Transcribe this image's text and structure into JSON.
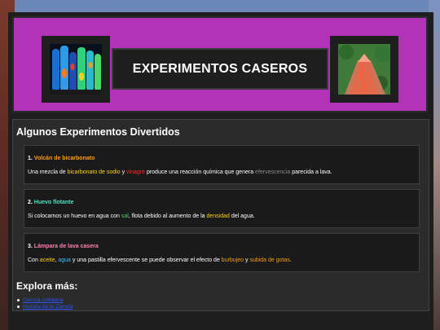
{
  "header": {
    "title": "EXPERIMENTOS CASEROS",
    "images": {
      "left": "lava-lamps-image",
      "right": "volcano-image"
    }
  },
  "main": {
    "section_title": "Algunos Experimentos Divertidos",
    "experiments": [
      {
        "number": "1.",
        "title": "Volcán de bicarbonato",
        "title_color": "#ff9a1a",
        "segments": [
          {
            "text": "Una mezcla de ",
            "color": "#ffffff"
          },
          {
            "text": "bicarbonato de sodio",
            "color": "#ffd21a"
          },
          {
            "text": " y ",
            "color": "#ffffff"
          },
          {
            "text": "vinagre",
            "color": "#ff2a2a"
          },
          {
            "text": " produce una reacción química que genera ",
            "color": "#ffffff"
          },
          {
            "text": "efervescencia",
            "color": "#8a8a8a"
          },
          {
            "text": " parecida a lava.",
            "color": "#ffffff"
          }
        ]
      },
      {
        "number": "2.",
        "title": "Huevo flotante",
        "title_color": "#4fe0c0",
        "segments": [
          {
            "text": "Si colocamos un huevo en agua con ",
            "color": "#ffffff"
          },
          {
            "text": "sal",
            "color": "#4fcf6a"
          },
          {
            "text": ", flota debido al aumento de la ",
            "color": "#ffffff"
          },
          {
            "text": "densidad",
            "color": "#ffd21a"
          },
          {
            "text": " del agua.",
            "color": "#ffffff"
          }
        ]
      },
      {
        "number": "3.",
        "title": "Lámpara de lava casera",
        "title_color": "#ff7fb0",
        "segments": [
          {
            "text": "Con ",
            "color": "#ffffff"
          },
          {
            "text": "aceite",
            "color": "#ffd21a"
          },
          {
            "text": ", ",
            "color": "#ffffff"
          },
          {
            "text": "agua",
            "color": "#3fc0ff"
          },
          {
            "text": " y una pastilla efervescente se puede observar el efecto de ",
            "color": "#ffffff"
          },
          {
            "text": "burbujeo",
            "color": "#ff9a1a"
          },
          {
            "text": " y ",
            "color": "#ffffff"
          },
          {
            "text": "subida de gotas",
            "color": "#ff9a1a"
          },
          {
            "text": ".",
            "color": "#ffffff"
          }
        ]
      }
    ],
    "explore_title": "Explora más:",
    "links": [
      {
        "label": "Ciencia cotidiana"
      },
      {
        "label": "Historia de la Ciencia"
      }
    ]
  },
  "colors": {
    "header_bg": "#b232b8",
    "panel_bg": "#1e1e1e",
    "content_bg": "#2b2b2b",
    "link": "#2a55ff"
  }
}
